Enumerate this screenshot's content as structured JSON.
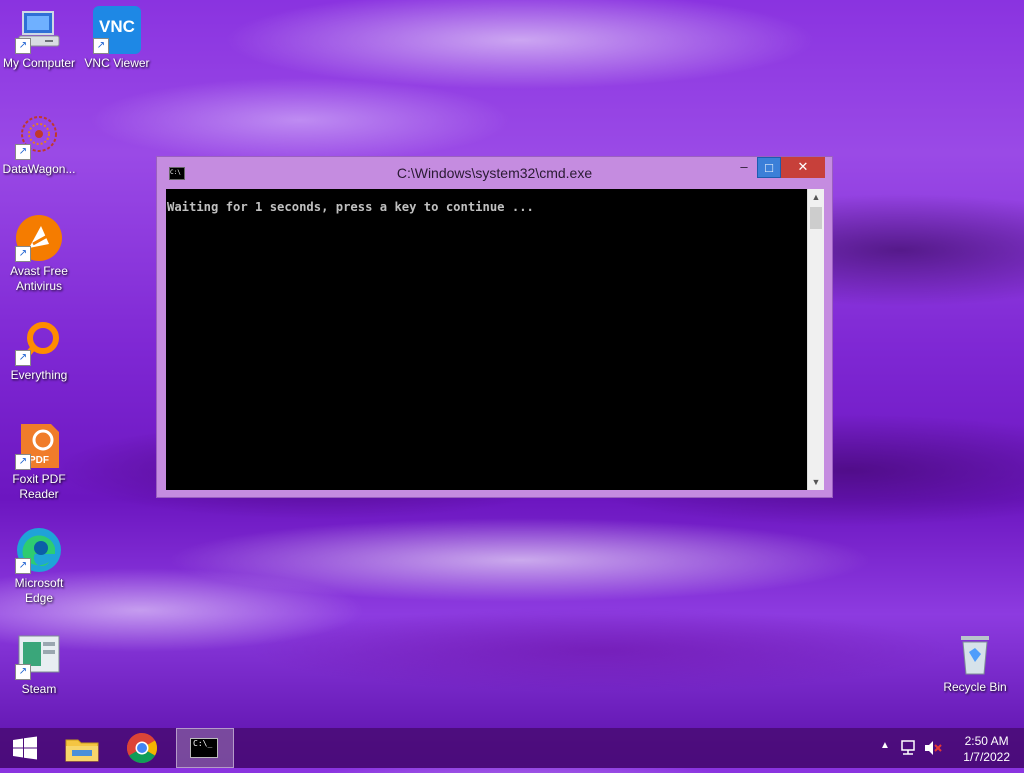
{
  "desktop": {
    "icons": [
      {
        "label": "My Computer"
      },
      {
        "label": "VNC Viewer"
      },
      {
        "label": "DataWagon..."
      },
      {
        "label": "Avast Free Antivirus"
      },
      {
        "label": "Everything"
      },
      {
        "label": "Foxit PDF Reader"
      },
      {
        "label": "Microsoft Edge"
      },
      {
        "label": "Steam"
      },
      {
        "label": "Recycle Bin"
      }
    ],
    "vnc_icon_text": "VNC",
    "foxit_icon_text": "PDF"
  },
  "cmd_window": {
    "title": "C:\\Windows\\system32\\cmd.exe",
    "icon_text": "C:\\",
    "console_text": "Waiting for 1 seconds, press a key to continue ...",
    "buttons": {
      "minimize": "–",
      "maximize": "□",
      "close": "✕"
    }
  },
  "taskbar": {
    "items": [
      "start-icon",
      "file-explorer-icon",
      "chrome-icon",
      "command-prompt-icon"
    ],
    "cmd_icon_text": "C:\\_"
  },
  "tray": {
    "time": "2:50 AM",
    "date": "1/7/2022"
  }
}
